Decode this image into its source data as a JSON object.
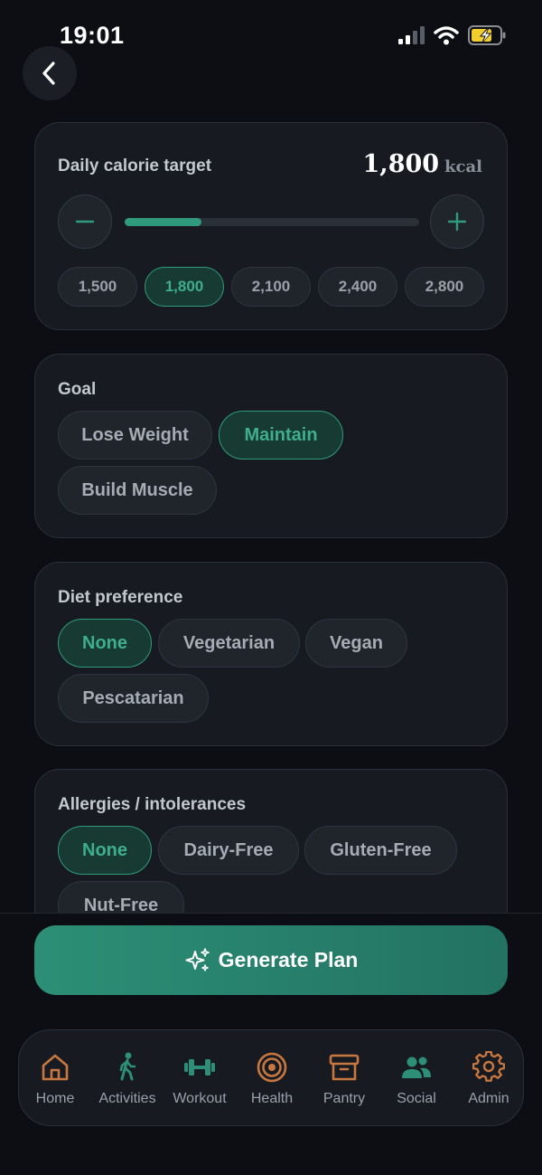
{
  "status_bar": {
    "time": "19:01"
  },
  "calorie_card": {
    "label": "Daily calorie target",
    "value": "1,800",
    "unit": "kcal",
    "slider_progress": 0.26,
    "presets": [
      {
        "label": "1,500",
        "selected": false
      },
      {
        "label": "1,800",
        "selected": true
      },
      {
        "label": "2,100",
        "selected": false
      },
      {
        "label": "2,400",
        "selected": false
      },
      {
        "label": "2,800",
        "selected": false
      }
    ]
  },
  "goal_card": {
    "label": "Goal",
    "options": [
      {
        "label": "Lose Weight",
        "selected": false
      },
      {
        "label": "Maintain",
        "selected": true
      },
      {
        "label": "Build Muscle",
        "selected": false
      }
    ]
  },
  "diet_card": {
    "label": "Diet preference",
    "options": [
      {
        "label": "None",
        "selected": true
      },
      {
        "label": "Vegetarian",
        "selected": false
      },
      {
        "label": "Vegan",
        "selected": false
      },
      {
        "label": "Pescatarian",
        "selected": false
      }
    ]
  },
  "allergy_card": {
    "label": "Allergies / intolerances",
    "options": [
      {
        "label": "None",
        "selected": true
      },
      {
        "label": "Dairy-Free",
        "selected": false
      },
      {
        "label": "Gluten-Free",
        "selected": false
      },
      {
        "label": "Nut-Free",
        "selected": false
      }
    ]
  },
  "generate_button": {
    "label": "Generate Plan",
    "icon": "sparkles-icon"
  },
  "tabs": [
    {
      "label": "Home",
      "icon": "home-icon",
      "color": "#c7773f"
    },
    {
      "label": "Activities",
      "icon": "walking-icon",
      "color": "#2e8f78"
    },
    {
      "label": "Workout",
      "icon": "dumbbell-icon",
      "color": "#2e8f78"
    },
    {
      "label": "Health",
      "icon": "target-icon",
      "color": "#c7773f"
    },
    {
      "label": "Pantry",
      "icon": "box-icon",
      "color": "#c7773f"
    },
    {
      "label": "Social",
      "icon": "users-icon",
      "color": "#2e8f78"
    },
    {
      "label": "Admin",
      "icon": "gear-icon",
      "color": "#c7773f"
    }
  ],
  "colors": {
    "accent": "#2f9c7d",
    "accent_text": "#3fae8d",
    "background": "#0c0e13",
    "card": "#171b21"
  }
}
